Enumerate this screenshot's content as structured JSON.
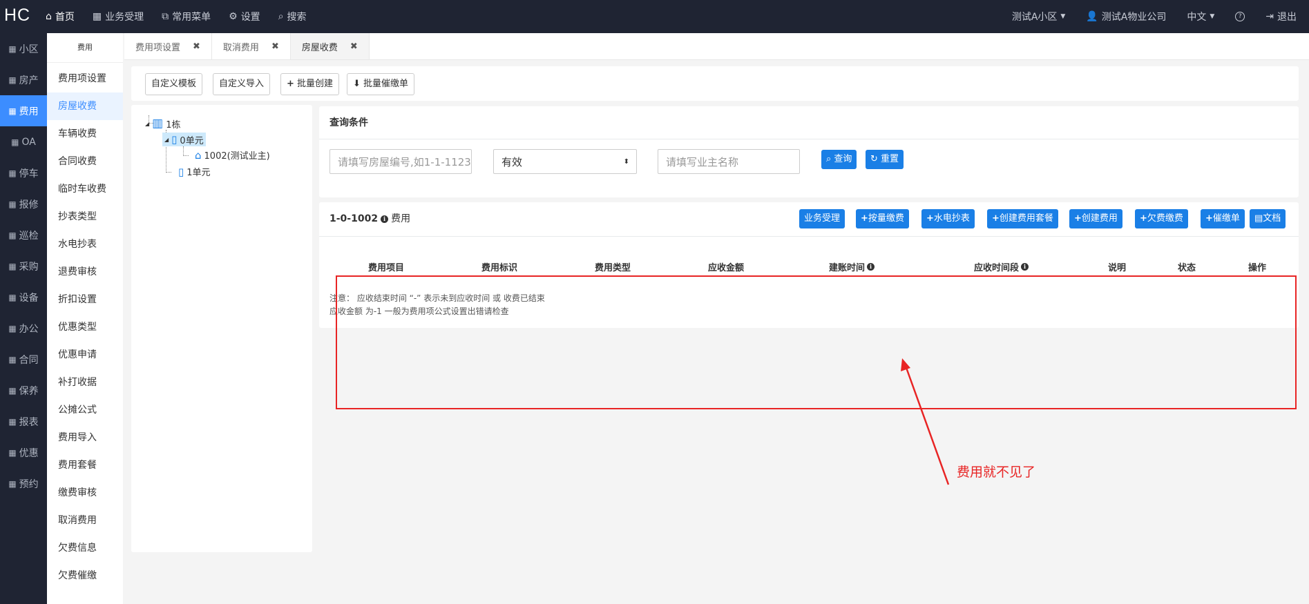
{
  "topbar": {
    "logo": "HC",
    "nav": [
      {
        "label": "首页",
        "icon": "home-icon",
        "glyph": "⌂"
      },
      {
        "label": "业务受理",
        "icon": "table-icon",
        "glyph": "▦"
      },
      {
        "label": "常用菜单",
        "icon": "sitemap-icon",
        "glyph": "⧉"
      },
      {
        "label": "设置",
        "icon": "gear-icon",
        "glyph": "⚙"
      },
      {
        "label": "搜索",
        "icon": "search-icon",
        "glyph": "⌕"
      }
    ],
    "community": "测试A小区",
    "company": "测试A物业公司",
    "language": "中文",
    "help_glyph": "?",
    "logout": "退出"
  },
  "rail": [
    {
      "label": "小区"
    },
    {
      "label": "房产"
    },
    {
      "label": "费用",
      "active": true
    },
    {
      "label": "OA"
    },
    {
      "label": "停车"
    },
    {
      "label": "报修"
    },
    {
      "label": "巡检"
    },
    {
      "label": "采购"
    },
    {
      "label": "设备"
    },
    {
      "label": "办公"
    },
    {
      "label": "合同"
    },
    {
      "label": "保养"
    },
    {
      "label": "报表"
    },
    {
      "label": "优惠"
    },
    {
      "label": "预约"
    }
  ],
  "submenu": {
    "title": "费用",
    "items": [
      "费用项设置",
      "房屋收费",
      "车辆收费",
      "合同收费",
      "临时车收费",
      "抄表类型",
      "水电抄表",
      "退费审核",
      "折扣设置",
      "优惠类型",
      "优惠申请",
      "补打收据",
      "公摊公式",
      "费用导入",
      "费用套餐",
      "缴费审核",
      "取消费用",
      "欠费信息",
      "欠费催缴"
    ],
    "active_index": 1
  },
  "tabs": [
    {
      "label": "费用项设置"
    },
    {
      "label": "取消费用"
    },
    {
      "label": "房屋收费",
      "active": true
    }
  ],
  "actions": {
    "custom_template": "自定义模板",
    "custom_import": "自定义导入",
    "batch_create": "批量创建",
    "batch_reminder": "批量催缴单"
  },
  "tree": {
    "building": "1栋",
    "unit0": "0单元",
    "room": "1002(测试业主)",
    "unit1": "1单元"
  },
  "query": {
    "title": "查询条件",
    "room_placeholder": "请填写房屋编号,如1-1-1123",
    "status_value": "有效",
    "owner_placeholder": "请填写业主名称",
    "search": "查询",
    "reset": "重置"
  },
  "fee": {
    "room_label": "1-0-1002",
    "title_suffix": "费用",
    "buttons": {
      "business": "业务受理",
      "bulk_pay": "按量缴费",
      "meter": "水电抄表",
      "create_package": "创建费用套餐",
      "create_fee": "创建费用",
      "arrears_pay": "欠费缴费",
      "reminder": "催缴单",
      "doc": "文档"
    },
    "columns": [
      "费用项目",
      "费用标识",
      "费用类型",
      "应收金额",
      "建账时间",
      "应收时间段",
      "说明",
      "状态",
      "操作"
    ],
    "notes": [
      "注意：  应收结束时间 “-” 表示未到应收时间 或 收费已结束",
      "应收金额 为-1 一般为费用项公式设置出错请检查"
    ]
  },
  "annotation": {
    "text": "费用就不见了",
    "color": "#e82424"
  }
}
